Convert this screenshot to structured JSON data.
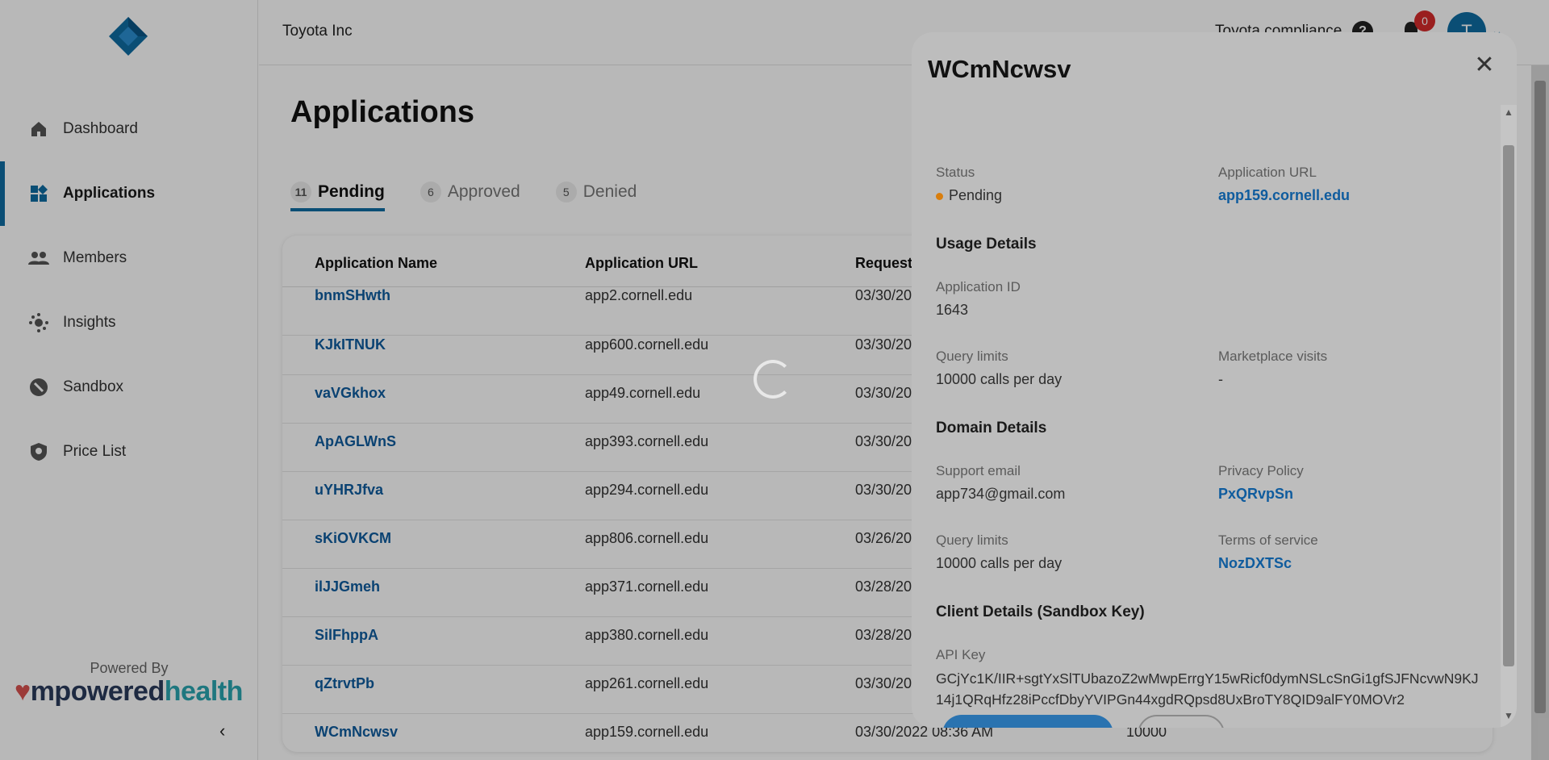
{
  "sidebar": {
    "items": [
      {
        "label": "Dashboard",
        "icon": "home-icon"
      },
      {
        "label": "Applications",
        "icon": "apps-grid-icon",
        "active": true
      },
      {
        "label": "Members",
        "icon": "people-icon"
      },
      {
        "label": "Insights",
        "icon": "insights-icon"
      },
      {
        "label": "Sandbox",
        "icon": "sandbox-icon"
      },
      {
        "label": "Price List",
        "icon": "shield-icon"
      }
    ],
    "powered_by": "Powered By",
    "brand_part1": "mpowered",
    "brand_part2": "health",
    "collapse_glyph": "‹"
  },
  "header": {
    "org_name": "Toyota Inc",
    "right_text": "Toyota compliance",
    "help_glyph": "?",
    "notification_count": "0",
    "avatar_initial": "T",
    "avatar_chevron": "⌄"
  },
  "main": {
    "title": "Applications",
    "tabs": [
      {
        "count": "11",
        "label": "Pending"
      },
      {
        "count": "6",
        "label": "Approved"
      },
      {
        "count": "5",
        "label": "Denied"
      }
    ],
    "table": {
      "columns": [
        "Application Name",
        "Application URL",
        "Request"
      ],
      "rows": [
        {
          "name": "bnmSHwth",
          "url": "app2.cornell.edu",
          "date": "03/30/20"
        },
        {
          "name": "KJkITNUK",
          "url": "app600.cornell.edu",
          "date": "03/30/20"
        },
        {
          "name": "vaVGkhox",
          "url": "app49.cornell.edu",
          "date": "03/30/20"
        },
        {
          "name": "ApAGLWnS",
          "url": "app393.cornell.edu",
          "date": "03/30/20"
        },
        {
          "name": "uYHRJfva",
          "url": "app294.cornell.edu",
          "date": "03/30/20"
        },
        {
          "name": "sKiOVKCM",
          "url": "app806.cornell.edu",
          "date": "03/26/20"
        },
        {
          "name": "ilJJGmeh",
          "url": "app371.cornell.edu",
          "date": "03/28/20"
        },
        {
          "name": "SilFhppA",
          "url": "app380.cornell.edu",
          "date": "03/28/20"
        },
        {
          "name": "qZtrvtPb",
          "url": "app261.cornell.edu",
          "date": "03/30/20"
        },
        {
          "name": "WCmNcwsv",
          "url": "app159.cornell.edu",
          "date": "03/30/2022 08:36 AM",
          "limit": "10000"
        }
      ]
    }
  },
  "modal": {
    "title": "WCmNcwsv",
    "close_glyph": "✕",
    "status_label": "Status",
    "status_value": "Pending",
    "app_url_label": "Application URL",
    "app_url_value": "app159.cornell.edu",
    "usage_section": "Usage Details",
    "app_id_label": "Application ID",
    "app_id_value": "1643",
    "query_limits_label": "Query limits",
    "query_limits_value": "10000 calls per day",
    "marketplace_label": "Marketplace visits",
    "marketplace_value": "-",
    "domain_section": "Domain Details",
    "support_email_label": "Support email",
    "support_email_value": "app734@gmail.com",
    "privacy_label": "Privacy Policy",
    "privacy_value": "PxQRvpSn",
    "domain_query_label": "Query limits",
    "domain_query_value": "10000 calls per day",
    "terms_label": "Terms of service",
    "terms_value": "NozDXTSc",
    "client_section": "Client Details (Sandbox Key)",
    "api_key_label": "API Key",
    "api_key_value": "GCjYc1K/IIR+sgtYxSlTUbazoZ2wMwpErrgY15wRicf0dymNSLcSnGi1gfSJFNcvwN9KJ14j1QRqHfz28iPccfDbyYVIPGn44xgdRQpsd8UxBroTY8QID9alFY0MOVr2"
  },
  "colors": {
    "accent": "#0f6da3",
    "link": "#0f5c9e",
    "pending_dot": "#d97e0d",
    "badge": "#d62b2b"
  }
}
